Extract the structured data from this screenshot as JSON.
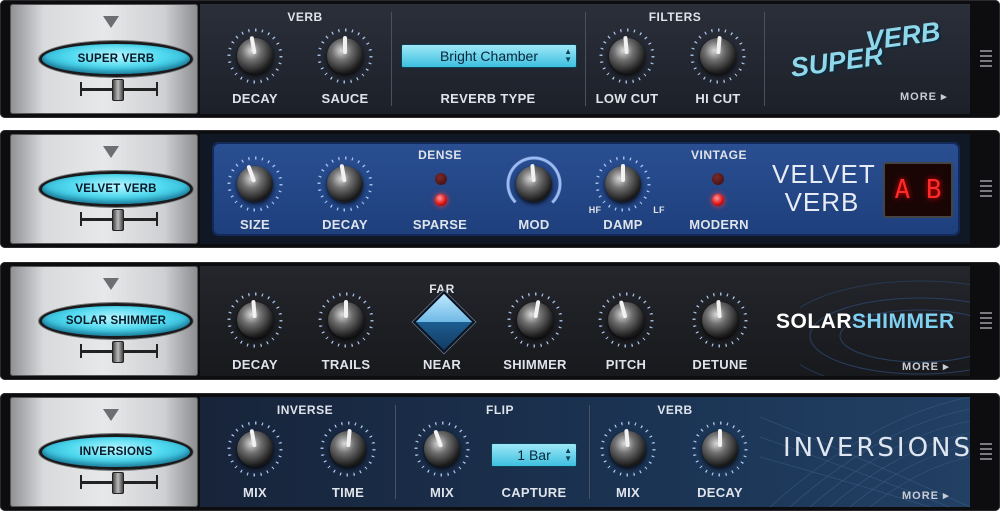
{
  "plugins": [
    {
      "name": "SUPER VERB",
      "sections": [
        "VERB",
        "FILTERS"
      ],
      "knobs": [
        "DECAY",
        "SAUCE",
        "LOW CUT",
        "HI CUT"
      ],
      "dropdown": {
        "value": "Bright Chamber",
        "label": "REVERB TYPE"
      },
      "logo": {
        "line1": "SUPER",
        "line2": "VERB"
      },
      "more": "MORE ▸"
    },
    {
      "name": "VELVET VERB",
      "knobs": [
        "SIZE",
        "DECAY",
        "MOD",
        "DAMP"
      ],
      "switch1": {
        "top": "DENSE",
        "bottom": "SPARSE"
      },
      "switch2": {
        "top": "VINTAGE",
        "bottom": "MODERN"
      },
      "damp_left": "HF",
      "damp_right": "LF",
      "logo": {
        "line1": "VELVET",
        "line2": "VERB"
      },
      "ab": "A B"
    },
    {
      "name": "SOLAR SHIMMER",
      "knobs": [
        "DECAY",
        "TRAILS",
        "SHIMMER",
        "PITCH",
        "DETUNE"
      ],
      "toggle": {
        "top": "FAR",
        "bottom": "NEAR"
      },
      "logo": {
        "part1": "SOLAR",
        "part2": "SHIMMER"
      },
      "more": "MORE ▸"
    },
    {
      "name": "INVERSIONS",
      "sections": [
        "INVERSE",
        "FLIP",
        "VERB"
      ],
      "knobs": [
        "MIX",
        "TIME",
        "MIX",
        "MIX",
        "DECAY"
      ],
      "dropdown": {
        "value": "1 Bar",
        "label": "CAPTURE"
      },
      "logo": "INVERSIONS",
      "more": "MORE ▸"
    }
  ],
  "colors": {
    "accent": "#4fd9ef",
    "velvet_blue": "#2a4f92",
    "led_red": "#e01515"
  }
}
